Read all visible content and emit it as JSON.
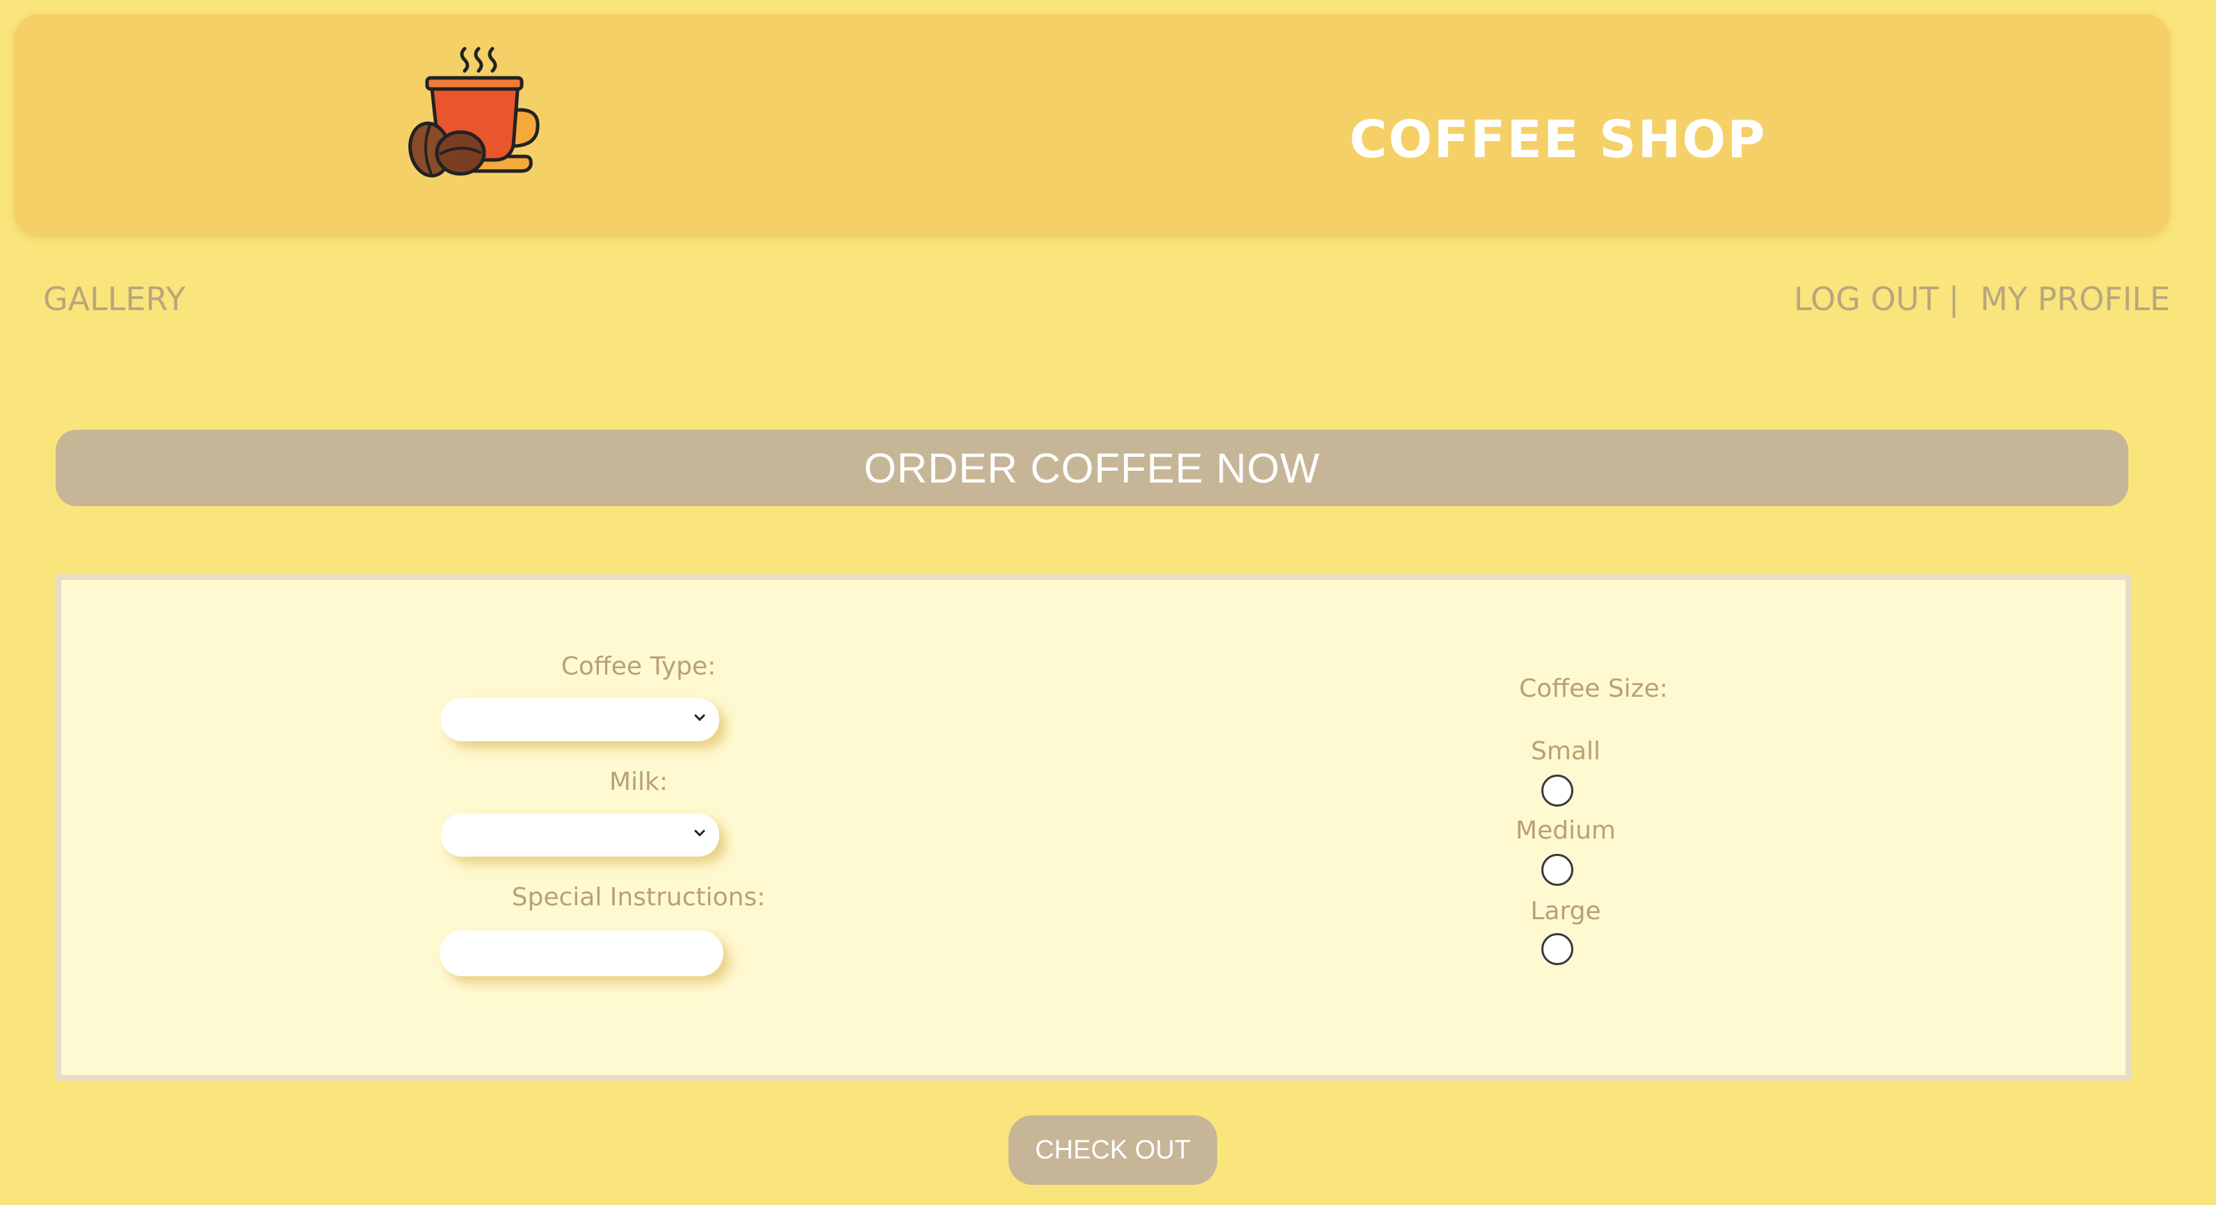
{
  "header": {
    "title": "COFFEE SHOP",
    "logo_icon": "coffee-cup-with-beans-icon"
  },
  "nav": {
    "gallery": "GALLERY",
    "logout": "LOG OUT",
    "separator": "|",
    "profile": "MY PROFILE"
  },
  "order": {
    "banner": "ORDER COFFEE NOW",
    "coffee_type_label": "Coffee Type:",
    "coffee_type_value": "",
    "milk_label": "Milk:",
    "milk_value": "",
    "special_label": "Special Instructions:",
    "special_value": "",
    "size_label": "Coffee Size:",
    "sizes": [
      "Small",
      "Medium",
      "Large"
    ],
    "selected_size": null,
    "checkout": "CHECK OUT"
  },
  "colors": {
    "background": "#fae57c",
    "header": "#f4d067",
    "accent": "#c6b697",
    "panel": "#fff9d1",
    "label": "#b8a172"
  }
}
